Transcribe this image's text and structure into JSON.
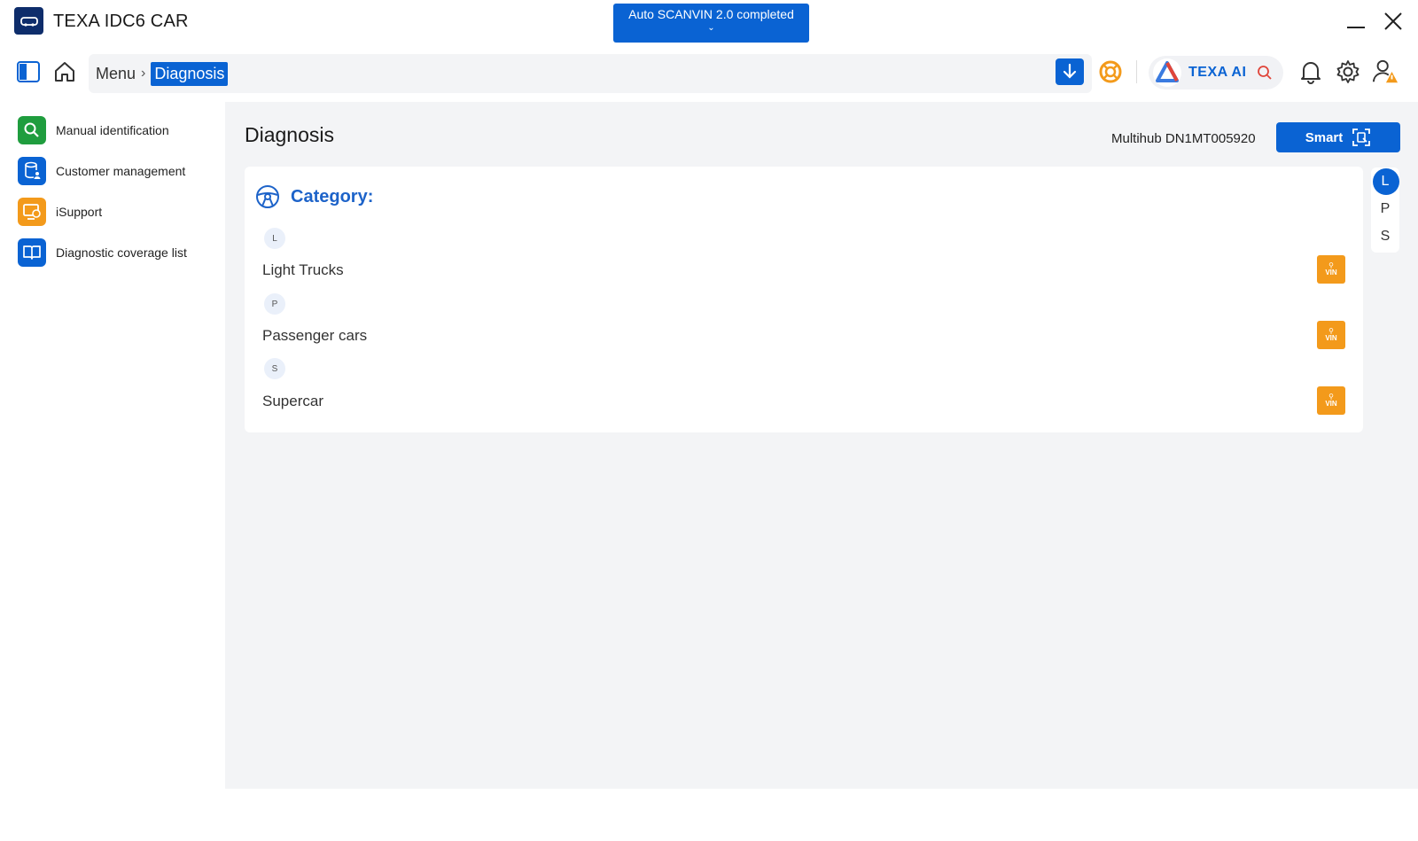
{
  "app": {
    "title": "TEXA IDC6 CAR"
  },
  "toast": {
    "text": "Auto SCANVIN 2.0 completed"
  },
  "breadcrumb": {
    "items": [
      "Menu",
      "Diagnosis"
    ]
  },
  "ai": {
    "label": "TEXA AI"
  },
  "sidebar": {
    "items": [
      {
        "label": "Manual identification",
        "icon": "magnifier-icon",
        "color": "#1f9d3e"
      },
      {
        "label": "Customer management",
        "icon": "database-user-icon",
        "color": "#0a63d3"
      },
      {
        "label": "iSupport",
        "icon": "support-screen-icon",
        "color": "#f39a1b"
      },
      {
        "label": "Diagnostic coverage list",
        "icon": "book-icon",
        "color": "#0a63d3"
      }
    ]
  },
  "main": {
    "title": "Diagnosis",
    "hub": "Multihub DN1MT005920",
    "smart_label": "Smart",
    "category_title": "Category:",
    "groups": [
      {
        "letter": "L",
        "name": "Light Trucks"
      },
      {
        "letter": "P",
        "name": "Passenger cars"
      },
      {
        "letter": "S",
        "name": "Supercar"
      }
    ],
    "vin_label": "VIN",
    "index": {
      "letters": [
        "L",
        "P",
        "S"
      ],
      "active": "L"
    }
  },
  "colors": {
    "accent": "#0a63d3",
    "vin": "#f39a1b",
    "success": "#1f9d3e"
  }
}
